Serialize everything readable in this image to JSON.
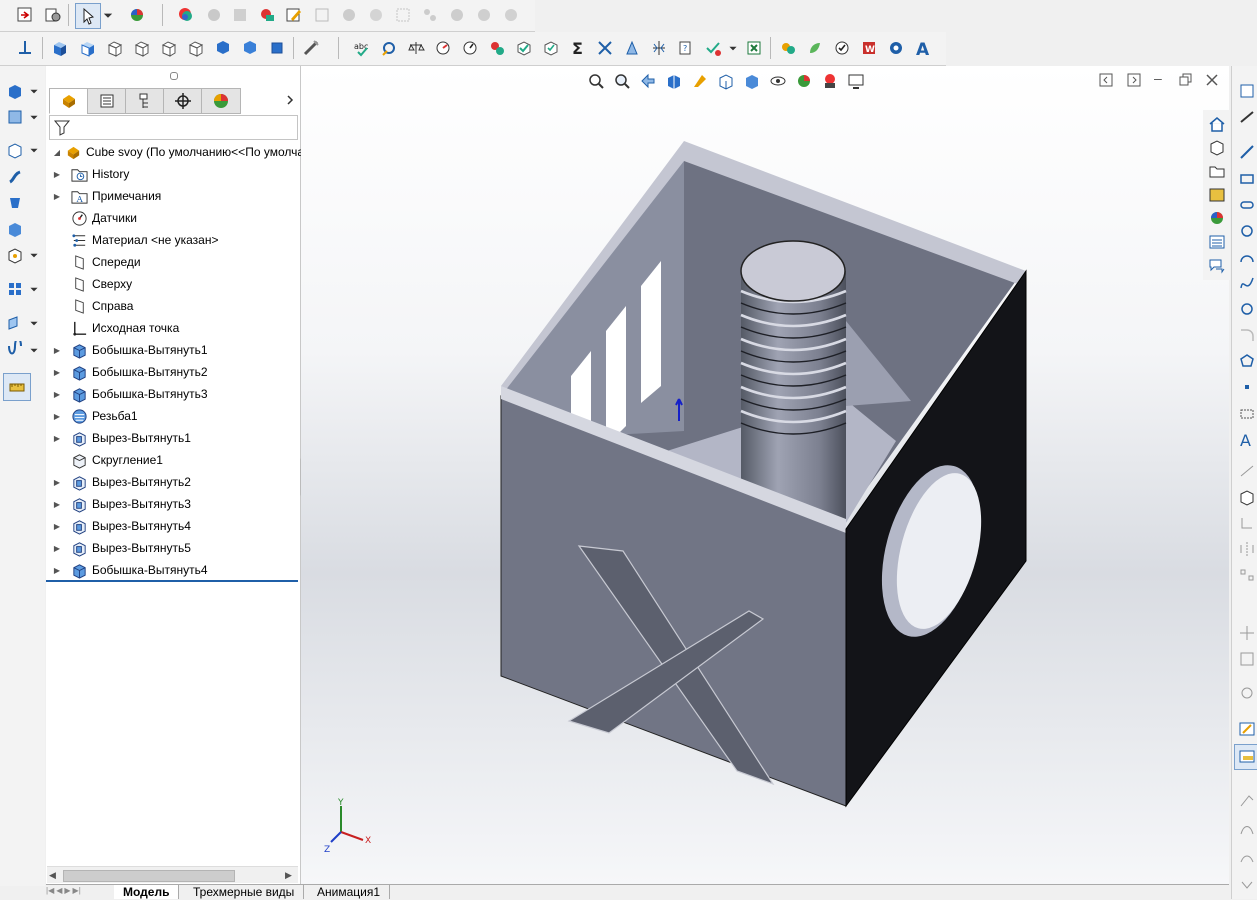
{
  "feature_tree": {
    "part_name": "Cube svoy  (По умолчанию<<По умолча",
    "items": [
      {
        "label": "History",
        "icon": "history-folder-icon",
        "expandable": true
      },
      {
        "label": "Примечания",
        "icon": "annotations-icon",
        "expandable": true
      },
      {
        "label": "Датчики",
        "icon": "sensors-icon",
        "expandable": false
      },
      {
        "label": "Материал <не указан>",
        "icon": "material-icon",
        "expandable": false
      },
      {
        "label": "Спереди",
        "icon": "plane-icon",
        "expandable": false
      },
      {
        "label": "Сверху",
        "icon": "plane-icon",
        "expandable": false
      },
      {
        "label": "Справа",
        "icon": "plane-icon",
        "expandable": false
      },
      {
        "label": "Исходная точка",
        "icon": "origin-icon",
        "expandable": false
      },
      {
        "label": "Бобышка-Вытянуть1",
        "icon": "extrude-boss-icon",
        "expandable": true
      },
      {
        "label": "Бобышка-Вытянуть2",
        "icon": "extrude-boss-icon",
        "expandable": true
      },
      {
        "label": "Бобышка-Вытянуть3",
        "icon": "extrude-boss-icon",
        "expandable": true
      },
      {
        "label": "Резьба1",
        "icon": "thread-icon",
        "expandable": true
      },
      {
        "label": "Вырез-Вытянуть1",
        "icon": "extrude-cut-icon",
        "expandable": true
      },
      {
        "label": "Скругление1",
        "icon": "fillet-icon",
        "expandable": false
      },
      {
        "label": "Вырез-Вытянуть2",
        "icon": "extrude-cut-icon",
        "expandable": true
      },
      {
        "label": "Вырез-Вытянуть3",
        "icon": "extrude-cut-icon",
        "expandable": true
      },
      {
        "label": "Вырез-Вытянуть4",
        "icon": "extrude-cut-icon",
        "expandable": true
      },
      {
        "label": "Вырез-Вытянуть5",
        "icon": "extrude-cut-icon",
        "expandable": true
      },
      {
        "label": "Бобышка-Вытянуть4",
        "icon": "extrude-boss-icon",
        "expandable": true
      }
    ]
  },
  "bottom_tabs": [
    "Модель",
    "Трехмерные виды",
    "Анимация1"
  ],
  "active_tab": "Модель",
  "triad": {
    "x": "X",
    "y": "Y",
    "z": "Z"
  },
  "model": {
    "engraved_letter": "X"
  },
  "colors": {
    "accent": "#1f5fa8",
    "model_face_dark": "#121318",
    "model_face_side": "#6f7382",
    "model_face_top": "#b8bac8"
  }
}
